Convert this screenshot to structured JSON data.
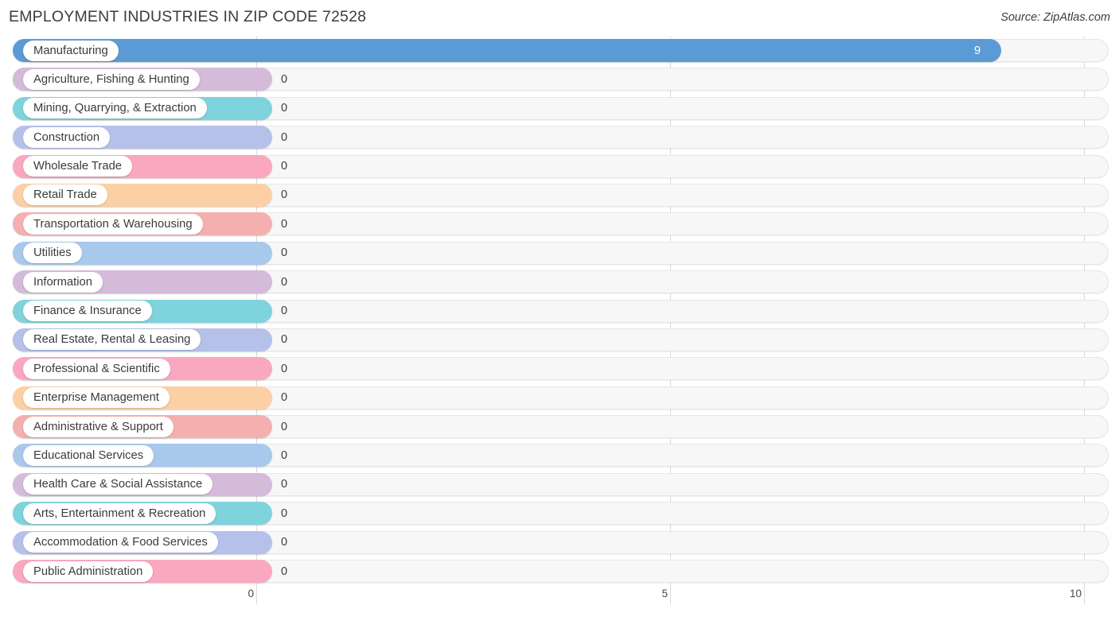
{
  "header": {
    "title": "EMPLOYMENT INDUSTRIES IN ZIP CODE 72528",
    "source": "Source: ZipAtlas.com"
  },
  "chart_data": {
    "type": "bar",
    "orientation": "horizontal",
    "title": "EMPLOYMENT INDUSTRIES IN ZIP CODE 72528",
    "subtitle": "Source: ZipAtlas.com",
    "xlabel": "",
    "ylabel": "",
    "xlim": [
      0,
      10
    ],
    "ticks": [
      "0",
      "5",
      "10"
    ],
    "tick_values": [
      0,
      5,
      10
    ],
    "grid": true,
    "legend": "none",
    "categories": [
      "Manufacturing",
      "Agriculture, Fishing & Hunting",
      "Mining, Quarrying, & Extraction",
      "Construction",
      "Wholesale Trade",
      "Retail Trade",
      "Transportation & Warehousing",
      "Utilities",
      "Information",
      "Finance & Insurance",
      "Real Estate, Rental & Leasing",
      "Professional & Scientific",
      "Enterprise Management",
      "Administrative & Support",
      "Educational Services",
      "Health Care & Social Assistance",
      "Arts, Entertainment & Recreation",
      "Accommodation & Food Services",
      "Public Administration"
    ],
    "values": [
      9,
      0,
      0,
      0,
      0,
      0,
      0,
      0,
      0,
      0,
      0,
      0,
      0,
      0,
      0,
      0,
      0,
      0,
      0
    ],
    "value_labels": [
      "9",
      "0",
      "0",
      "0",
      "0",
      "0",
      "0",
      "0",
      "0",
      "0",
      "0",
      "0",
      "0",
      "0",
      "0",
      "0",
      "0",
      "0",
      "0"
    ],
    "colors": [
      "#5b9bd5",
      "#d4bbd9",
      "#7fd3dd",
      "#b6c1ea",
      "#f9a8c0",
      "#fcd0a4",
      "#f4b0ae",
      "#a8c8ec",
      "#d4bbd9",
      "#7fd3dd",
      "#b6c1ea",
      "#f9a8c0",
      "#fcd0a4",
      "#f4b0ae",
      "#a8c8ec",
      "#d4bbd9",
      "#7fd3dd",
      "#b6c1ea",
      "#f9a8c0"
    ]
  },
  "axis": {
    "labels": [
      "0",
      "5",
      "10"
    ]
  },
  "theme": {
    "track_bg": "#f7f7f7",
    "track_border": "#e6e6e6",
    "gridline": "#d9d9d9",
    "text": "#3b3b3b",
    "page_bg": "#ffffff"
  }
}
